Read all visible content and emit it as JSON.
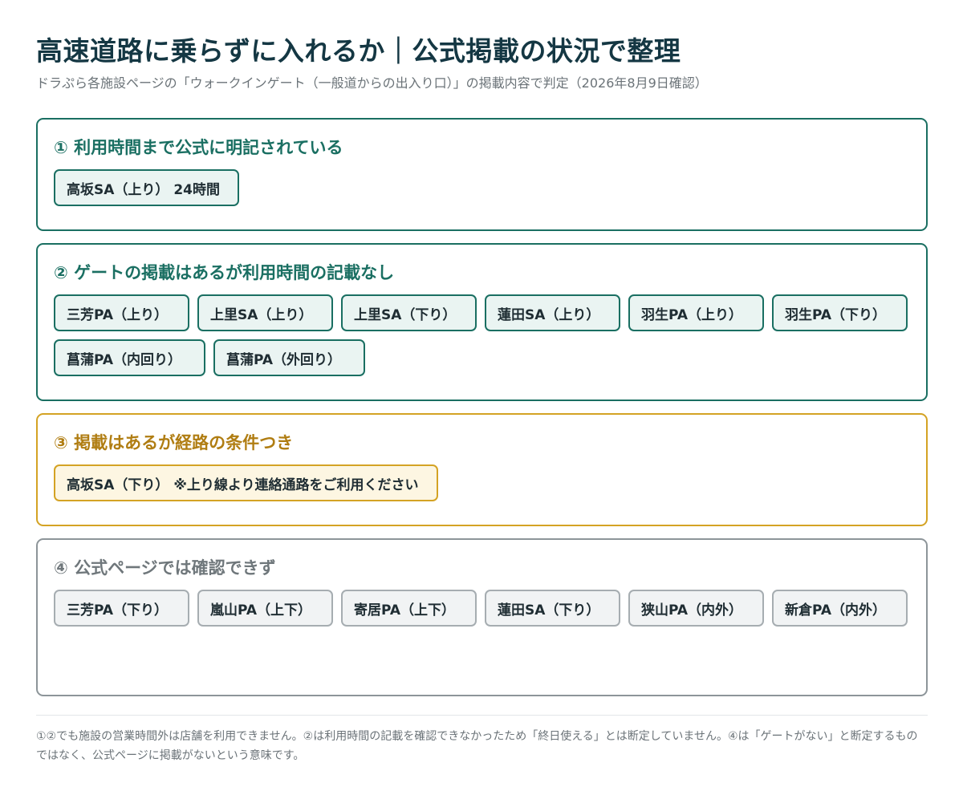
{
  "header": {
    "title": "高速道路に乗らずに入れるか｜公式掲載の状況で整理",
    "subtitle": "ドラぷら各施設ページの「ウォークインゲート（一般道からの出入り口）」の掲載内容で判定（2026年8月9日確認）"
  },
  "sections": [
    {
      "heading": "① 利用時間まで公式に明記されている",
      "color": "#1a6f62",
      "items": [
        "高坂SA（上り） 24時間"
      ]
    },
    {
      "heading": "② ゲートの掲載はあるが利用時間の記載なし",
      "color": "#1a6f62",
      "items": [
        "三芳PA（上り）",
        "上里SA（上り）",
        "上里SA（下り）",
        "蓮田SA（上り）",
        "羽生PA（上り）",
        "羽生PA（下り）",
        "菖蒲PA（内回り）",
        "菖蒲PA（外回り）"
      ]
    },
    {
      "heading": "③ 掲載はあるが経路の条件つき",
      "color": "#b07d12",
      "items": [
        "高坂SA（下り） ※上り線より連絡通路をご利用ください"
      ]
    },
    {
      "heading": "④ 公式ページでは確認できず",
      "color": "#6f777b",
      "items": [
        "三芳PA（下り）",
        "嵐山PA（上下）",
        "寄居PA（上下）",
        "蓮田SA（下り）",
        "狭山PA（内外）",
        "新倉PA（内外）"
      ]
    }
  ],
  "footnote": "①②でも施設の営業時間外は店舗を利用できません。②は利用時間の記載を確認できなかったため「終日使える」とは断定していません。④は「ゲートがない」と断定するものではなく、公式ページに掲載がないという意味です。"
}
